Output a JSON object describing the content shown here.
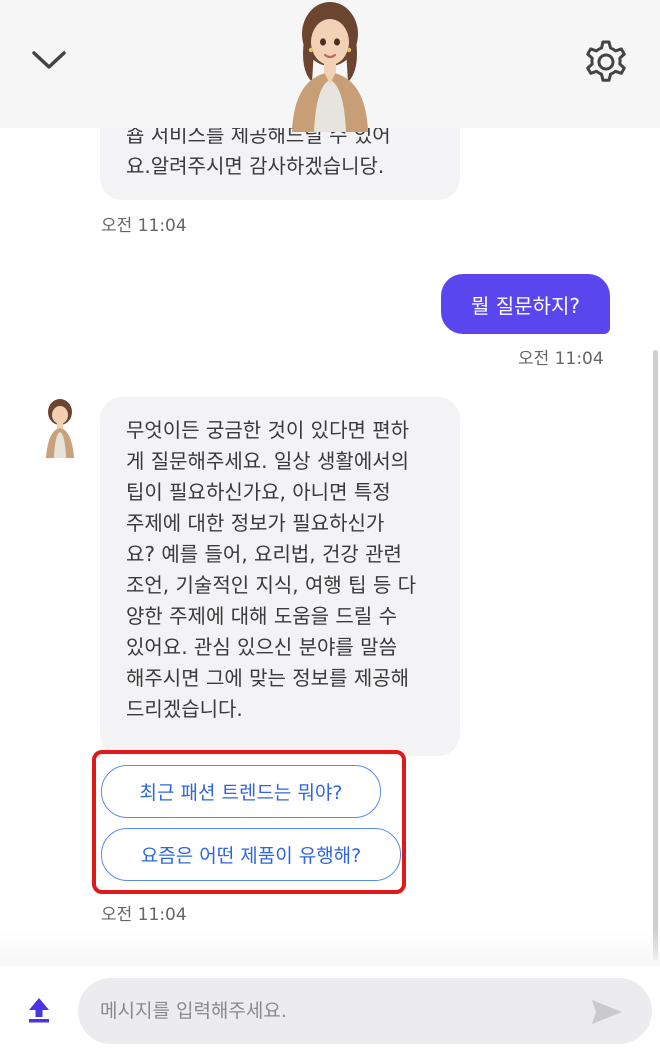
{
  "header": {
    "close_icon": "chevron-down-icon",
    "settings_icon": "gear-icon"
  },
  "messages": [
    {
      "role": "bot",
      "lines": [
        "숍 서비스를 제공해드릴 수 있어",
        "요.알려주시면 감사하겠습니당."
      ],
      "time": "오전 11:04"
    },
    {
      "role": "user",
      "text": "뭘 질문하지?",
      "time": "오전 11:04"
    },
    {
      "role": "bot",
      "lines": [
        "무엇이든 궁금한 것이 있다면 편하",
        "게 질문해주세요. 일상 생활에서의",
        "팁이 필요하신가요, 아니면 특정",
        "주제에 대한 정보가 필요하신가",
        "요? 예를 들어, 요리법, 건강 관련",
        "조언, 기술적인 지식, 여행 팁 등 다",
        "양한 주제에 대해 도움을 드릴 수",
        "있어요. 관심 있으신 분야를 말씀",
        "해주시면 그에 맞는 정보를 제공해",
        "드리겠습니다."
      ],
      "suggestions": [
        "최근 패션 트렌드는 뭐야?",
        "요즘은 어떤 제품이 유행해?"
      ],
      "time": "오전 11:04"
    }
  ],
  "composer": {
    "placeholder": "메시지를 입력해주세요.",
    "upload_icon": "upload-icon",
    "send_icon": "send-icon"
  },
  "colors": {
    "accent": "#5a46ee",
    "suggestion": "#2f66e0",
    "highlight": "#e01818"
  }
}
